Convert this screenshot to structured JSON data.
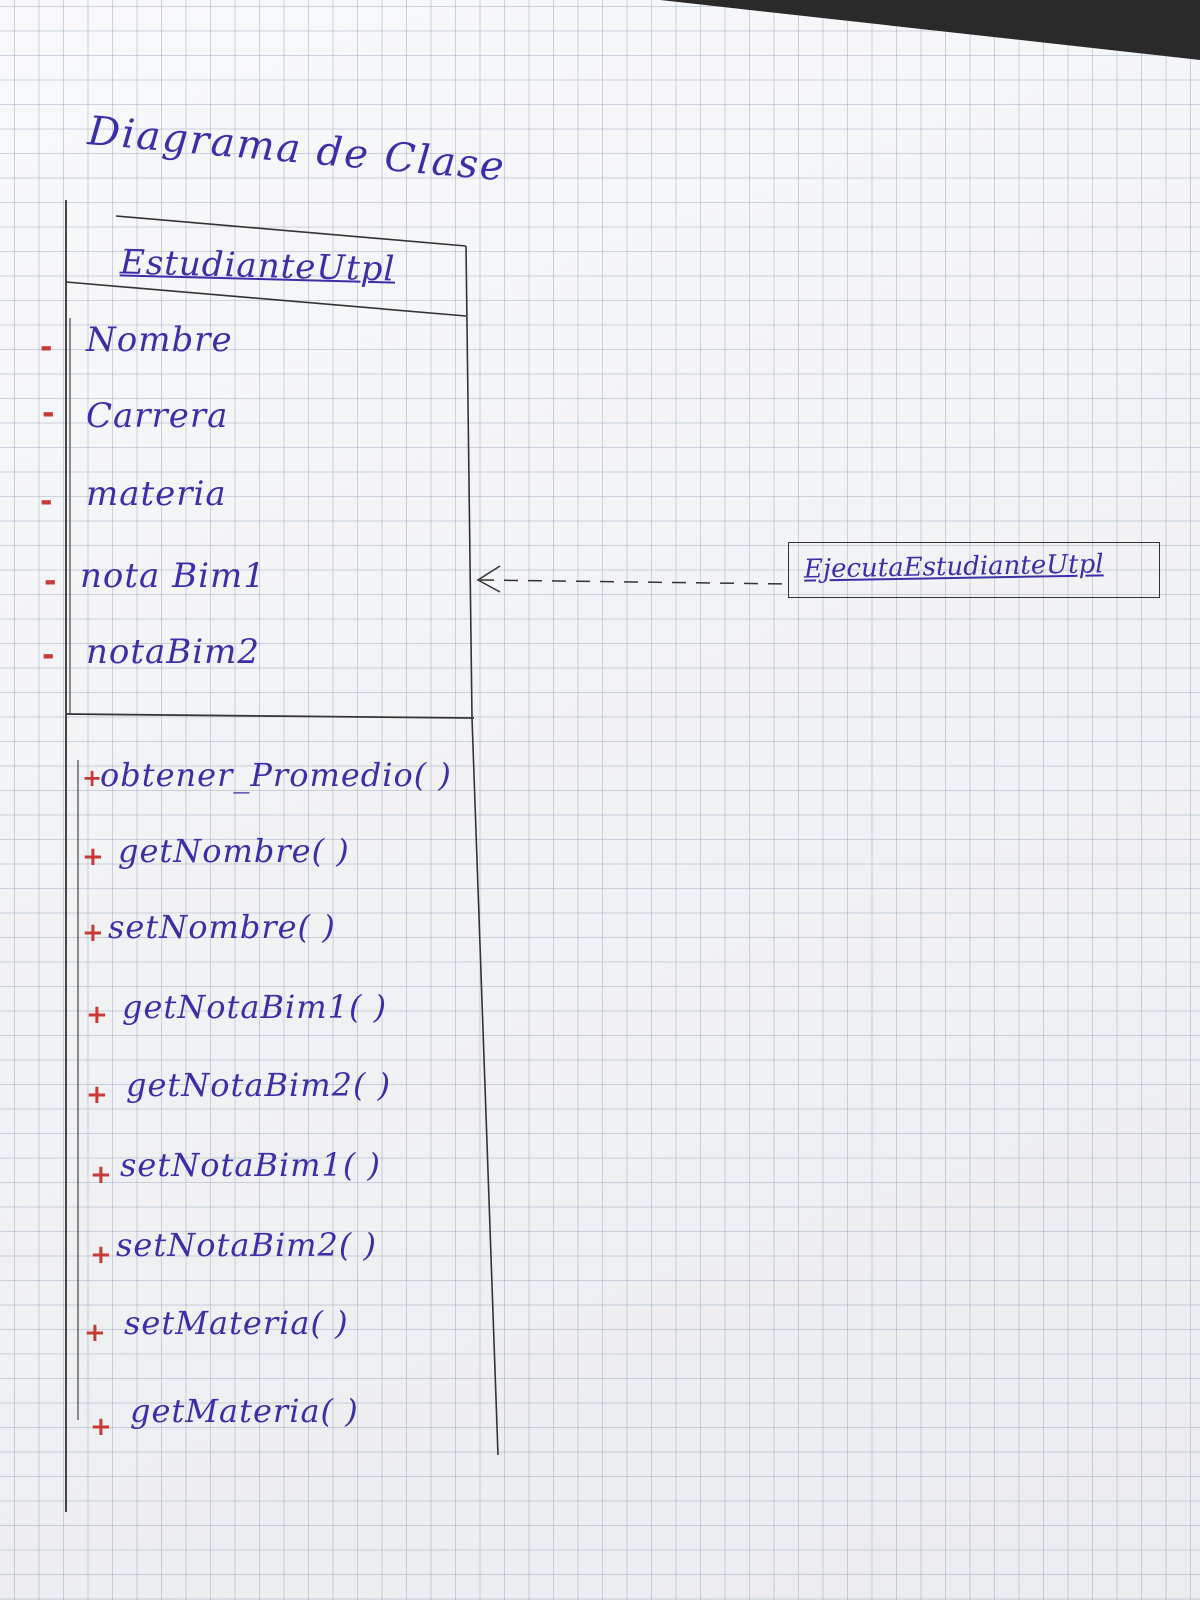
{
  "diagram": {
    "title": "Diagrama de Clase",
    "class": {
      "name": "EstudianteUtpl",
      "attributes": [
        {
          "visibility": "-",
          "name": "Nombre"
        },
        {
          "visibility": "-",
          "name": "Carrera"
        },
        {
          "visibility": "-",
          "name": "materia"
        },
        {
          "visibility": "-",
          "name": "nota Bim1"
        },
        {
          "visibility": "-",
          "name": "notaBim2"
        }
      ],
      "methods": [
        {
          "visibility": "+",
          "name": "obtener_Promedio( )"
        },
        {
          "visibility": "+",
          "name": "getNombre( )"
        },
        {
          "visibility": "+",
          "name": "setNombre( )"
        },
        {
          "visibility": "+",
          "name": "getNotaBim1( )"
        },
        {
          "visibility": "+",
          "name": "getNotaBim2( )"
        },
        {
          "visibility": "+",
          "name": "setNotaBim1( )"
        },
        {
          "visibility": "+",
          "name": "setNotaBim2( )"
        },
        {
          "visibility": "+",
          "name": "setMateria( )"
        },
        {
          "visibility": "+",
          "name": "getMateria( )"
        }
      ]
    },
    "dependent_class": {
      "name": "EjecutaEstudianteUtpl"
    },
    "relationship": {
      "type": "dependency",
      "from": "EjecutaEstudianteUtpl",
      "to": "EstudianteUtpl"
    },
    "colors": {
      "ink_blue": "#3b2fa8",
      "ink_red": "#c83a36",
      "pencil": "#333333",
      "paper": "#f4f5f8"
    }
  }
}
